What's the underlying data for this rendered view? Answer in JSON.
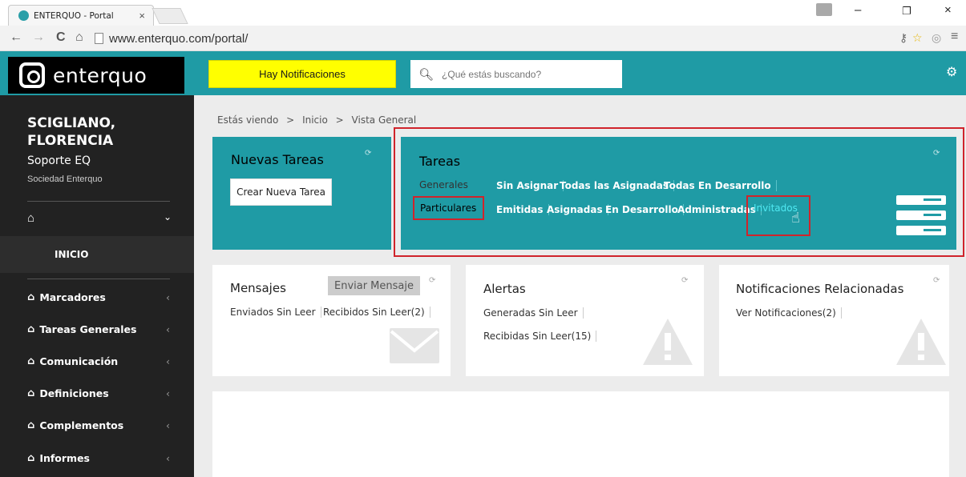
{
  "browser": {
    "tab_title": "ENTERQUO - Portal",
    "tab_close": "×",
    "url": "www.enterquo.com/portal/",
    "win_min": "–",
    "win_max": "❐",
    "win_close": "×",
    "nav_back": "←",
    "nav_forward": "→",
    "nav_reload": "C",
    "nav_home": "⌂",
    "key_icon": "⚷",
    "star_icon": "☆",
    "menu_icon": "≡",
    "ext_icon": "◎"
  },
  "header": {
    "logo_text": "enterquo",
    "notifications_label": "Hay Notificaciones",
    "search_placeholder": "¿Qué estás buscando?",
    "accent_color": "#1f9ba5",
    "notification_color": "#ffff00"
  },
  "sidebar": {
    "user_name": "SCIGLIANO, FLORENCIA",
    "user_role": "Soporte EQ",
    "user_org": "Sociedad Enterquo",
    "home_chevron": "⌄",
    "active_item": "INICIO",
    "items": [
      {
        "label": "Marcadores",
        "icon": "home-icon"
      },
      {
        "label": "Tareas Generales",
        "icon": "home-icon"
      },
      {
        "label": "Comunicación",
        "icon": "home-icon"
      },
      {
        "label": "Definiciones",
        "icon": "home-icon"
      },
      {
        "label": "Complementos",
        "icon": "home-icon"
      },
      {
        "label": "Informes",
        "icon": "home-icon"
      }
    ]
  },
  "breadcrumb": {
    "prefix": "Estás viendo",
    "sep": ">",
    "items": [
      "Inicio",
      "Vista General"
    ]
  },
  "nuevas_tareas": {
    "title": "Nuevas Tareas",
    "button": "Crear Nueva Tarea"
  },
  "tareas": {
    "title": "Tareas",
    "generales_label": "Generales",
    "generales_links": [
      "Sin Asignar",
      "Todas las Asignadas",
      "Todas En Desarrollo"
    ],
    "particulares_label": "Particulares",
    "particulares_links": [
      "Emitidas",
      "Asignadas",
      "En Desarrollo",
      "Administradas",
      "Invitados"
    ],
    "highlight_color": "#d0242b",
    "hover_link_color": "#4fe9f2"
  },
  "mensajes": {
    "title": "Mensajes",
    "button": "Enviar Mensaje",
    "links": [
      "Enviados Sin Leer",
      "Recibidos Sin Leer(2)"
    ]
  },
  "alertas": {
    "title": "Alertas",
    "links": [
      "Generadas Sin Leer",
      "Recibidas Sin Leer(15)"
    ]
  },
  "notificaciones": {
    "title": "Notificaciones Relacionadas",
    "links": [
      "Ver Notificaciones(2)"
    ]
  }
}
